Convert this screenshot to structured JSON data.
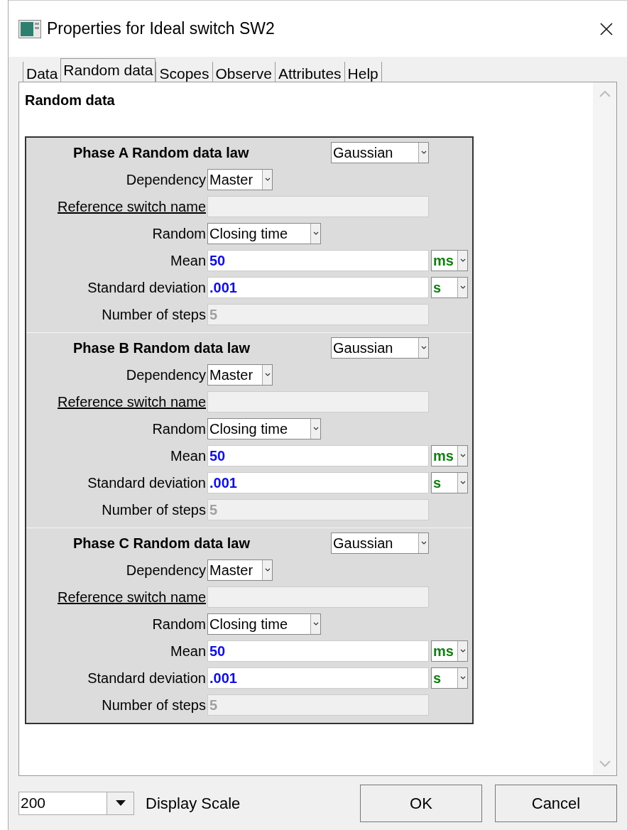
{
  "window": {
    "title": "Properties for Ideal switch SW2"
  },
  "tabs": [
    {
      "label": "Data",
      "selected": false
    },
    {
      "label": "Random data",
      "selected": true
    },
    {
      "label": "Scopes",
      "selected": false
    },
    {
      "label": "Observe",
      "selected": false
    },
    {
      "label": "Attributes",
      "selected": false
    },
    {
      "label": "Help",
      "selected": false
    }
  ],
  "heading": "Random data",
  "phases": [
    {
      "title": "Phase A Random data law",
      "law": "Gaussian",
      "fields": [
        {
          "kind": "select",
          "label": "Dependency",
          "value": "Master"
        },
        {
          "kind": "link",
          "label": "Reference switch name"
        },
        {
          "kind": "wide-select",
          "label": "Random",
          "value": "Closing time"
        },
        {
          "kind": "unit",
          "label": "Mean",
          "value": "50",
          "unit": "ms"
        },
        {
          "kind": "unit",
          "label": "Standard deviation",
          "value": ".001",
          "unit": "s"
        },
        {
          "kind": "readonly",
          "label": "Number of steps",
          "value": "5"
        }
      ]
    },
    {
      "title": "Phase B Random data law",
      "law": "Gaussian",
      "fields": [
        {
          "kind": "select",
          "label": "Dependency",
          "value": "Master"
        },
        {
          "kind": "link",
          "label": "Reference switch name"
        },
        {
          "kind": "wide-select",
          "label": "Random",
          "value": "Closing time"
        },
        {
          "kind": "unit",
          "label": "Mean",
          "value": "50",
          "unit": "ms"
        },
        {
          "kind": "unit",
          "label": "Standard deviation",
          "value": ".001",
          "unit": "s"
        },
        {
          "kind": "readonly",
          "label": "Number of steps",
          "value": "5"
        }
      ]
    },
    {
      "title": "Phase C Random data law",
      "law": "Gaussian",
      "fields": [
        {
          "kind": "select",
          "label": "Dependency",
          "value": "Master"
        },
        {
          "kind": "link",
          "label": "Reference switch name"
        },
        {
          "kind": "wide-select",
          "label": "Random",
          "value": "Closing time"
        },
        {
          "kind": "unit",
          "label": "Mean",
          "value": "50",
          "unit": "ms"
        },
        {
          "kind": "unit",
          "label": "Standard deviation",
          "value": ".001",
          "unit": "s"
        },
        {
          "kind": "readonly",
          "label": "Number of steps",
          "value": "5"
        }
      ]
    }
  ],
  "footer": {
    "scale": "200",
    "scale_label": "Display Scale",
    "buttons": [
      "OK",
      "Cancel"
    ]
  }
}
